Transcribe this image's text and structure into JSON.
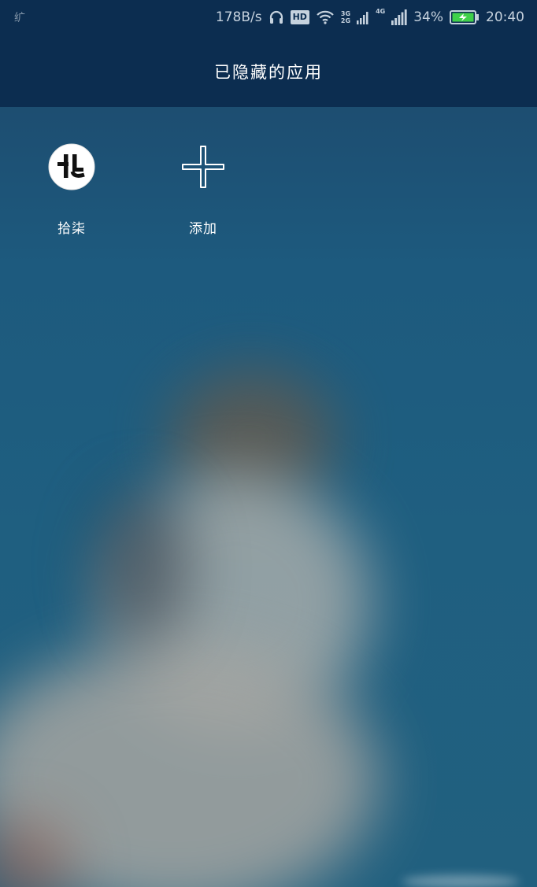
{
  "status_bar": {
    "left_indicator": "纩",
    "network_speed": "178B/s",
    "hd_label": "HD",
    "network_type_1": "3G",
    "network_type_2": "2G",
    "network_type_3": "4G",
    "battery_percent": "34%",
    "time": "20:40",
    "icons": [
      "headphones-icon",
      "hd-icon",
      "wifi-icon",
      "signal-icon",
      "battery-charging-icon"
    ]
  },
  "header": {
    "title": "已隐藏的应用"
  },
  "apps": [
    {
      "label": "拾柒",
      "icon": "app-shiqi-icon"
    },
    {
      "label": "添加",
      "icon": "add-icon"
    }
  ],
  "colors": {
    "header_bg": "#0c2d50",
    "wallpaper": "#1d5a7d",
    "battery_fill": "#3fd14a"
  }
}
